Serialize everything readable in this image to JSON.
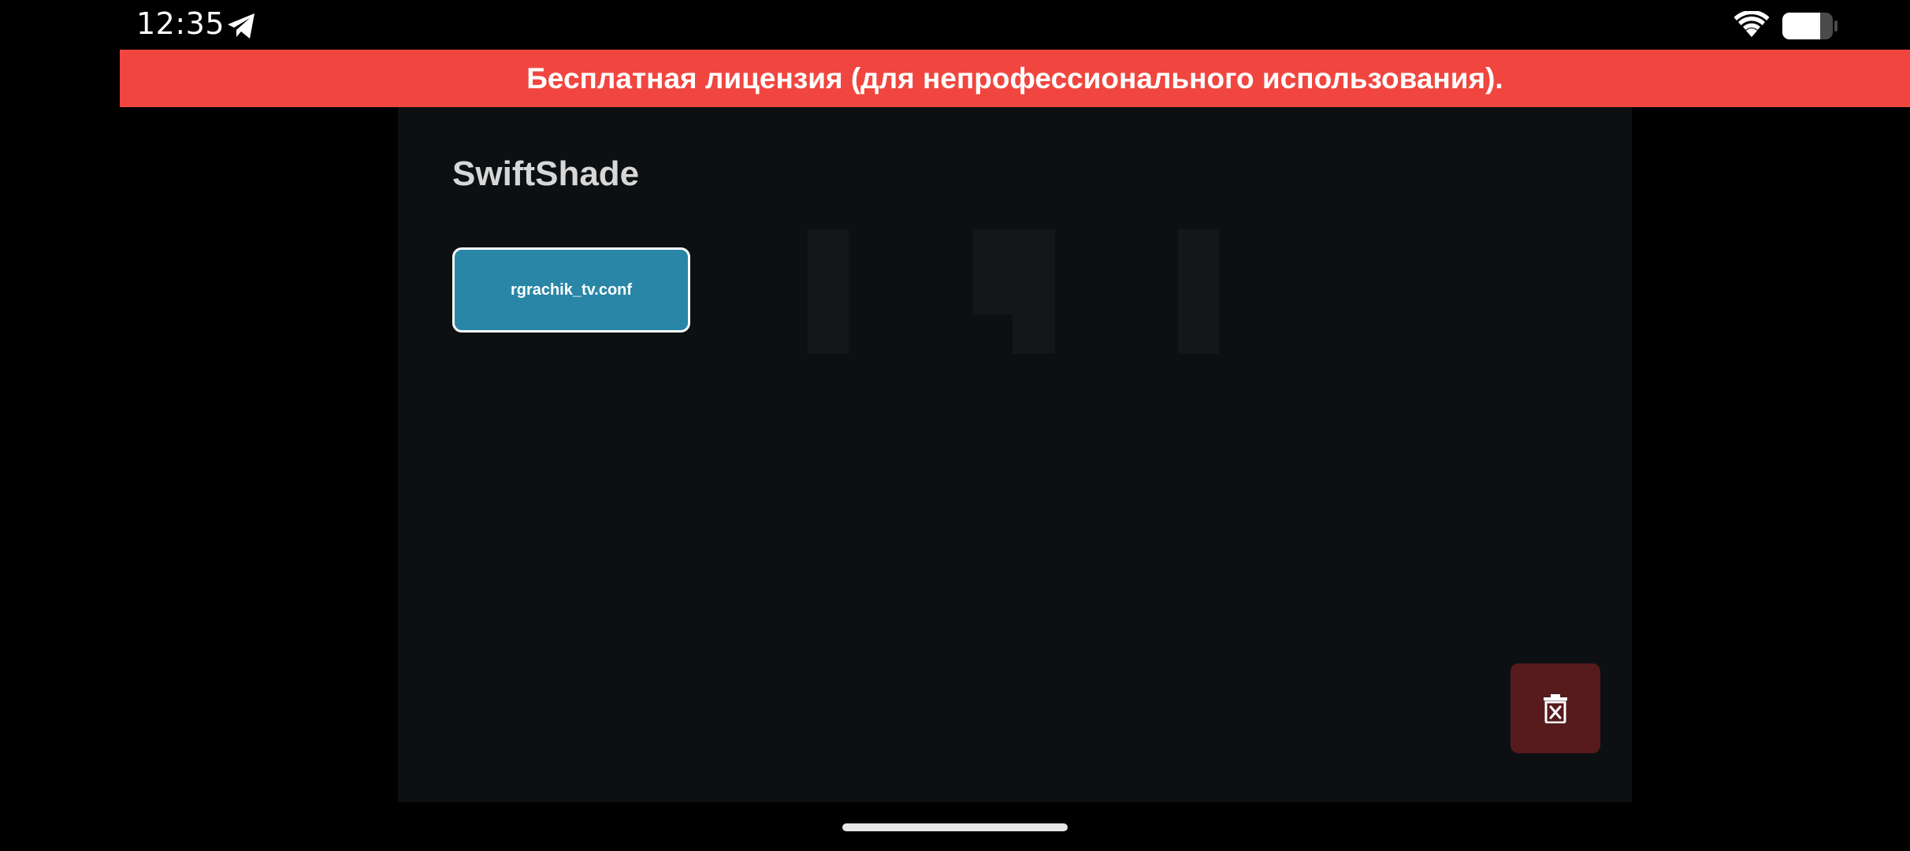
{
  "status_bar": {
    "time": "12:35",
    "icons": [
      "telegram-icon",
      "wifi-icon",
      "battery-icon"
    ]
  },
  "banner": {
    "text": "Бесплатная лицензия (для непрофессионального использования).",
    "color": "#f0463f"
  },
  "panel": {
    "title": "SwiftShade",
    "configs": [
      {
        "label": "rgrachik_tv.conf"
      }
    ],
    "delete_button_icon": "trash-close-icon"
  },
  "colors": {
    "config_button": "#2a86a6",
    "delete_button": "#571a1d",
    "panel_background": "#0d1012"
  }
}
